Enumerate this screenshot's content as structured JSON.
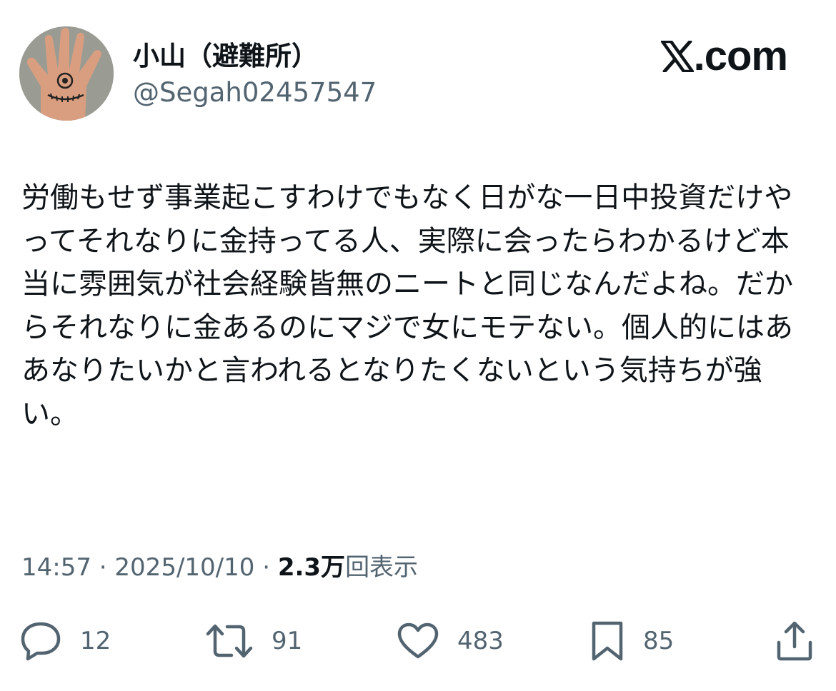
{
  "tweet": {
    "author": {
      "display_name": "小山（避難所）",
      "handle": "@Segah02457547"
    },
    "brand": {
      "logo_icon": "x-logo-icon",
      "label": ".com"
    },
    "text": "労働もせず事業起こすわけでもなく日がな一日中投資だけやってそれなりに金持ってる人、実際に会ったらわかるけど本当に雰囲気が社会経験皆無のニートと同じなんだよね。だからそれなりに金あるのにマジで女にモテない。個人的にはああなりたいかと言われるとなりたくないという気持ちが強い。",
    "meta": {
      "time": "14:57",
      "separator_1": " · ",
      "date": "2025/10/10",
      "separator_2": " · ",
      "views_count": "2.3万",
      "views_label": "回表示"
    },
    "actions": {
      "replies": {
        "icon": "reply-icon",
        "count": "12"
      },
      "retweets": {
        "icon": "retweet-icon",
        "count": "91"
      },
      "likes": {
        "icon": "heart-icon",
        "count": "483"
      },
      "bookmarks": {
        "icon": "bookmark-icon",
        "count": "85"
      },
      "share": {
        "icon": "share-icon"
      }
    }
  },
  "colors": {
    "primary_text": "#0f1419",
    "secondary_text": "#536471",
    "background": "#ffffff"
  }
}
